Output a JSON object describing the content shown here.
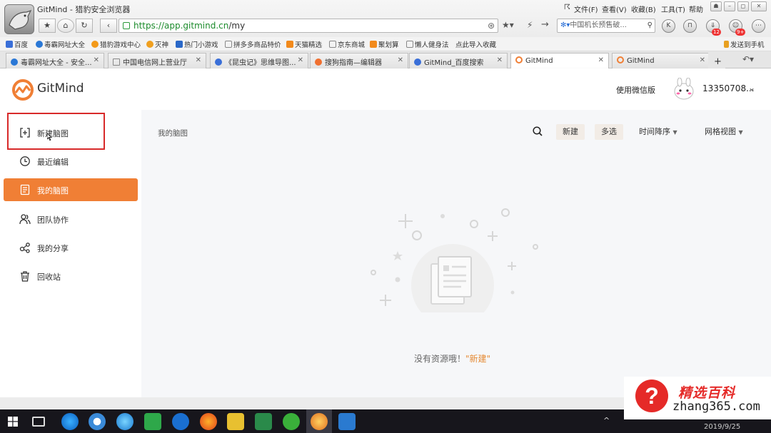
{
  "browser": {
    "window_title": "GitMind - 猎豹安全浏览器",
    "menu": [
      "文件(F)",
      "查看(V)",
      "收藏(B)",
      "工具(T)",
      "帮助"
    ],
    "url_host": "https://app.gitmind.cn",
    "url_path": "/my",
    "search_placeholder": "中国机长预售破...",
    "badges": [
      "12",
      "9+"
    ],
    "bookmarks": [
      "百度",
      "毒霸网址大全",
      "猎豹游戏中心",
      "灭神",
      "热门小游戏",
      "拼多多商品特价",
      "天猫精选",
      "京东商城",
      "聚划算",
      "懒人健身法",
      "点此导入收藏"
    ],
    "send_to_phone": "发送到手机",
    "tabs": [
      {
        "title": "毒霸网址大全 - 安全..."
      },
      {
        "title": "中国电信网上营业厅"
      },
      {
        "title": "《昆虫记》思维导图..."
      },
      {
        "title": "搜狗指南—编辑器"
      },
      {
        "title": "GitMind_百度搜索"
      },
      {
        "title": "GitMind"
      },
      {
        "title": "GitMind"
      }
    ],
    "new_tab": "+"
  },
  "app": {
    "brand": "GitMind",
    "wechat_version": "使用微信版",
    "username": "13350708...",
    "sidebar": [
      {
        "label": "新建脑图",
        "icon": "new-mindmap-icon"
      },
      {
        "label": "最近编辑",
        "icon": "clock-icon"
      },
      {
        "label": "我的脑图",
        "icon": "document-icon"
      },
      {
        "label": "团队协作",
        "icon": "team-icon"
      },
      {
        "label": "我的分享",
        "icon": "share-icon"
      },
      {
        "label": "回收站",
        "icon": "trash-icon"
      }
    ],
    "breadcrumb": "我的脑图",
    "toolbar": {
      "new": "新建",
      "multi_select": "多选",
      "sort": "时间降序",
      "view": "网格视图"
    },
    "empty_state": {
      "text": "没有资源哦！",
      "link": "\"新建\""
    },
    "accent_color": "#f07f35"
  },
  "taskbar": {
    "date": "2019/9/25"
  },
  "watermark": {
    "title": "精选百科",
    "url": "zhang365.com"
  }
}
